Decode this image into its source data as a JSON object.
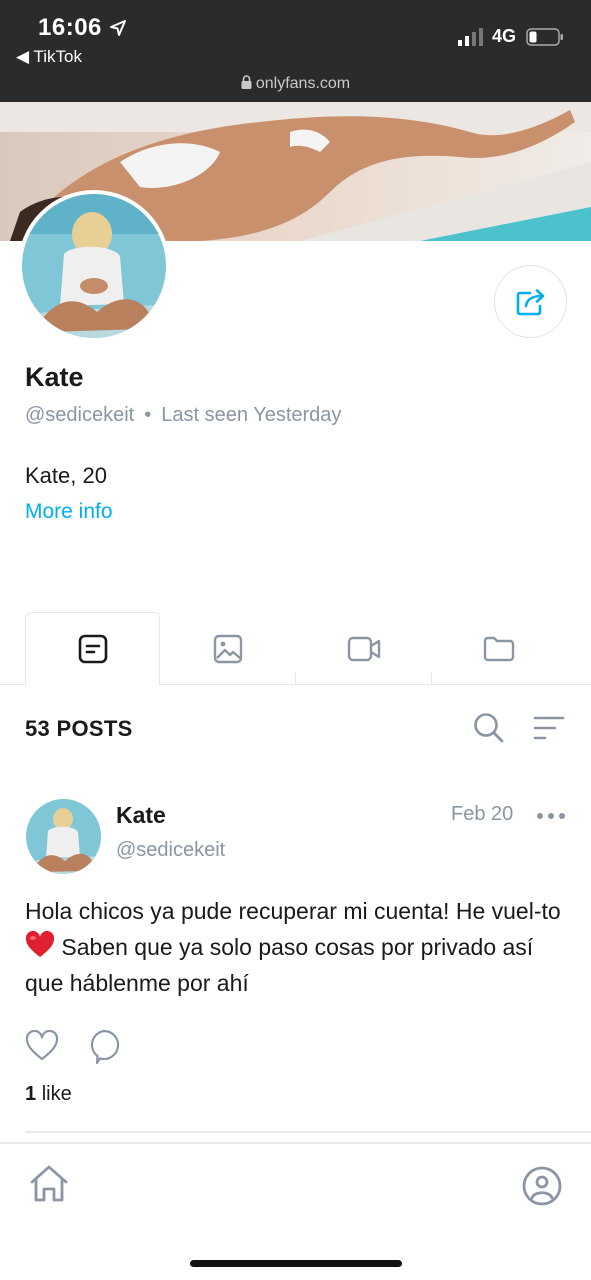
{
  "status_bar": {
    "time": "16:06",
    "back_app": "◀ TikTok",
    "network": "4G",
    "url": "onlyfans.com"
  },
  "profile": {
    "name": "Kate",
    "handle": "@sedicekeit",
    "separator": "•",
    "last_seen": "Last seen Yesterday",
    "bio": "Kate, 20",
    "more_info": "More info"
  },
  "tabs": [
    {
      "name": "posts",
      "icon": "post-icon",
      "active": true
    },
    {
      "name": "photos",
      "icon": "image-icon",
      "active": false
    },
    {
      "name": "videos",
      "icon": "video-icon",
      "active": false
    },
    {
      "name": "folders",
      "icon": "folder-icon",
      "active": false
    }
  ],
  "posts_section": {
    "count_label": "53 POSTS"
  },
  "post": {
    "author_name": "Kate",
    "author_handle": "@sedicekeit",
    "date": "Feb 20",
    "text_part1": "Hola chicos ya pude recuperar mi cuenta! He vuel-to",
    "text_part2": "Saben que ya solo paso cosas por privado así que háblenme por ahí",
    "likes_count": "1",
    "likes_label": "like"
  },
  "colors": {
    "accent": "#00aff0",
    "muted": "#8a96a3",
    "status_bar_bg": "#2b2b2b"
  }
}
